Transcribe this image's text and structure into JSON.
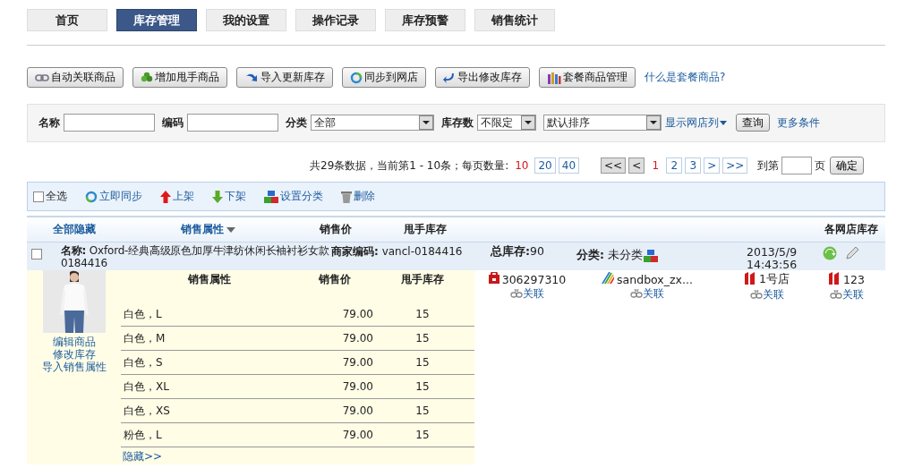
{
  "nav_tabs": [
    {
      "label": "首页",
      "selected": false
    },
    {
      "label": "库存管理",
      "selected": true
    },
    {
      "label": "我的设置",
      "selected": false
    },
    {
      "label": "操作记录",
      "selected": false
    },
    {
      "label": "库存预警",
      "selected": false
    },
    {
      "label": "销售统计",
      "selected": false
    }
  ],
  "toolbar": {
    "buttons": [
      {
        "label": "自动关联商品",
        "kind": "link"
      },
      {
        "label": "增加甩手商品",
        "kind": "add"
      },
      {
        "label": "导入更新库存",
        "kind": "import"
      },
      {
        "label": "同步到网店",
        "kind": "sync"
      },
      {
        "label": "导出修改库存",
        "kind": "export"
      },
      {
        "label": "套餐商品管理",
        "kind": "bundle"
      }
    ],
    "help_link": "什么是套餐商品?"
  },
  "filters": {
    "name_label": "名称",
    "code_label": "编码",
    "category_label": "分类",
    "category_value": "全部",
    "stock_label": "库存数",
    "stock_value": "不限定",
    "sort_value": "默认排序",
    "shop_columns_link": "显示网店列",
    "query_button": "查询",
    "more_link": "更多条件"
  },
  "pagination": {
    "summary": "共29条数据，当前第1 - 10条；每页数量:",
    "page_sizes": [
      {
        "label": "10",
        "selected": true
      },
      {
        "label": "20",
        "selected": false
      },
      {
        "label": "40",
        "selected": false
      }
    ],
    "first": "<<",
    "prev": "<",
    "pages": [
      {
        "label": "1",
        "selected": true
      },
      {
        "label": "2",
        "selected": false
      },
      {
        "label": "3",
        "selected": false
      }
    ],
    "next": ">",
    "last": ">>",
    "goto_prefix": "到第",
    "goto_suffix": "页",
    "confirm_button": "确定"
  },
  "actions": {
    "select_all": {
      "label": "全选",
      "checked": false
    },
    "items": [
      {
        "label": "立即同步",
        "kind": "sync"
      },
      {
        "label": "上架",
        "kind": "up"
      },
      {
        "label": "下架",
        "kind": "down"
      },
      {
        "label": "设置分类",
        "kind": "category"
      },
      {
        "label": "删除",
        "kind": "delete"
      }
    ]
  },
  "table": {
    "columns": [
      "全部隐藏",
      "销售属性",
      "销售价",
      "甩手库存",
      "各网店库存"
    ],
    "product": {
      "checked": false,
      "name_label": "名称:",
      "name": "Oxford-经典高级原色加厚牛津纺休闲长袖衬衫女款 0184416",
      "code_label": "商家编码:",
      "code": "vancl-0184416",
      "total_label": "总库存:",
      "total": "90",
      "category_label": "分类:",
      "category": "未分类",
      "date": "2013/5/9",
      "time": "14:43:56",
      "links": [
        "编辑商品",
        "修改库存",
        "导入销售属性"
      ],
      "variant_columns": [
        "销售属性",
        "销售价",
        "甩手库存"
      ],
      "variants": [
        {
          "attribute": "白色，L",
          "price": "79.00",
          "stock": "15"
        },
        {
          "attribute": "白色，M",
          "price": "79.00",
          "stock": "15"
        },
        {
          "attribute": "白色，S",
          "price": "79.00",
          "stock": "15"
        },
        {
          "attribute": "白色，XL",
          "price": "79.00",
          "stock": "15"
        },
        {
          "attribute": "白色，XS",
          "price": "79.00",
          "stock": "15"
        },
        {
          "attribute": "粉色，L",
          "price": "79.00",
          "stock": "15"
        }
      ],
      "hide_link": "隐藏>>",
      "shops": [
        {
          "name": "306297310",
          "kind": "bag",
          "link": "关联"
        },
        {
          "name": "sandbox_zx...",
          "kind": "stripes",
          "link": "关联"
        },
        {
          "name": "1号店",
          "kind": "number",
          "link": "关联"
        },
        {
          "name": "123",
          "kind": "number",
          "link": "关联"
        }
      ]
    }
  }
}
